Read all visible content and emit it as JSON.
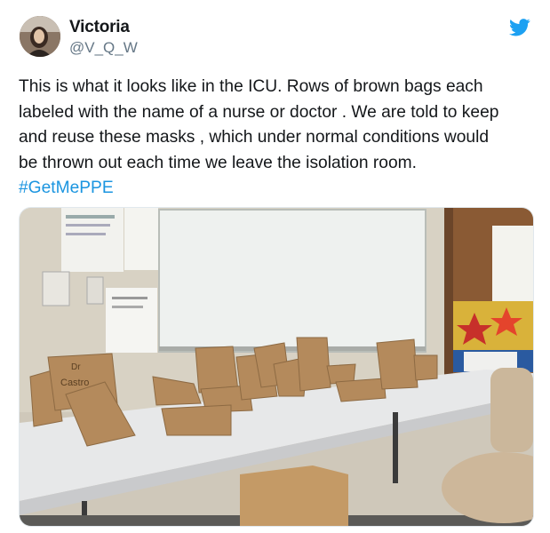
{
  "user": {
    "display_name": "Victoria",
    "handle": "@V_Q_W",
    "avatar_icon": "profile-photo-icon"
  },
  "platform_icon": "twitter-bird-icon",
  "colors": {
    "twitter_blue": "#1da1f2",
    "hashtag": "#1b95e0",
    "text": "#14171a",
    "secondary_text": "#657786"
  },
  "tweet": {
    "lines": [
      "This is what it looks like in the ICU. Rows of brown bags each",
      "labeled with the name of a nurse or doctor . We are told to keep",
      "and reuse these masks , which under normal conditions would",
      "be thrown out each time we leave the isolation room."
    ],
    "hashtag": "#GetMePPE"
  },
  "photo": {
    "bag_label_1": "Dr",
    "bag_label_2": "Castro"
  }
}
